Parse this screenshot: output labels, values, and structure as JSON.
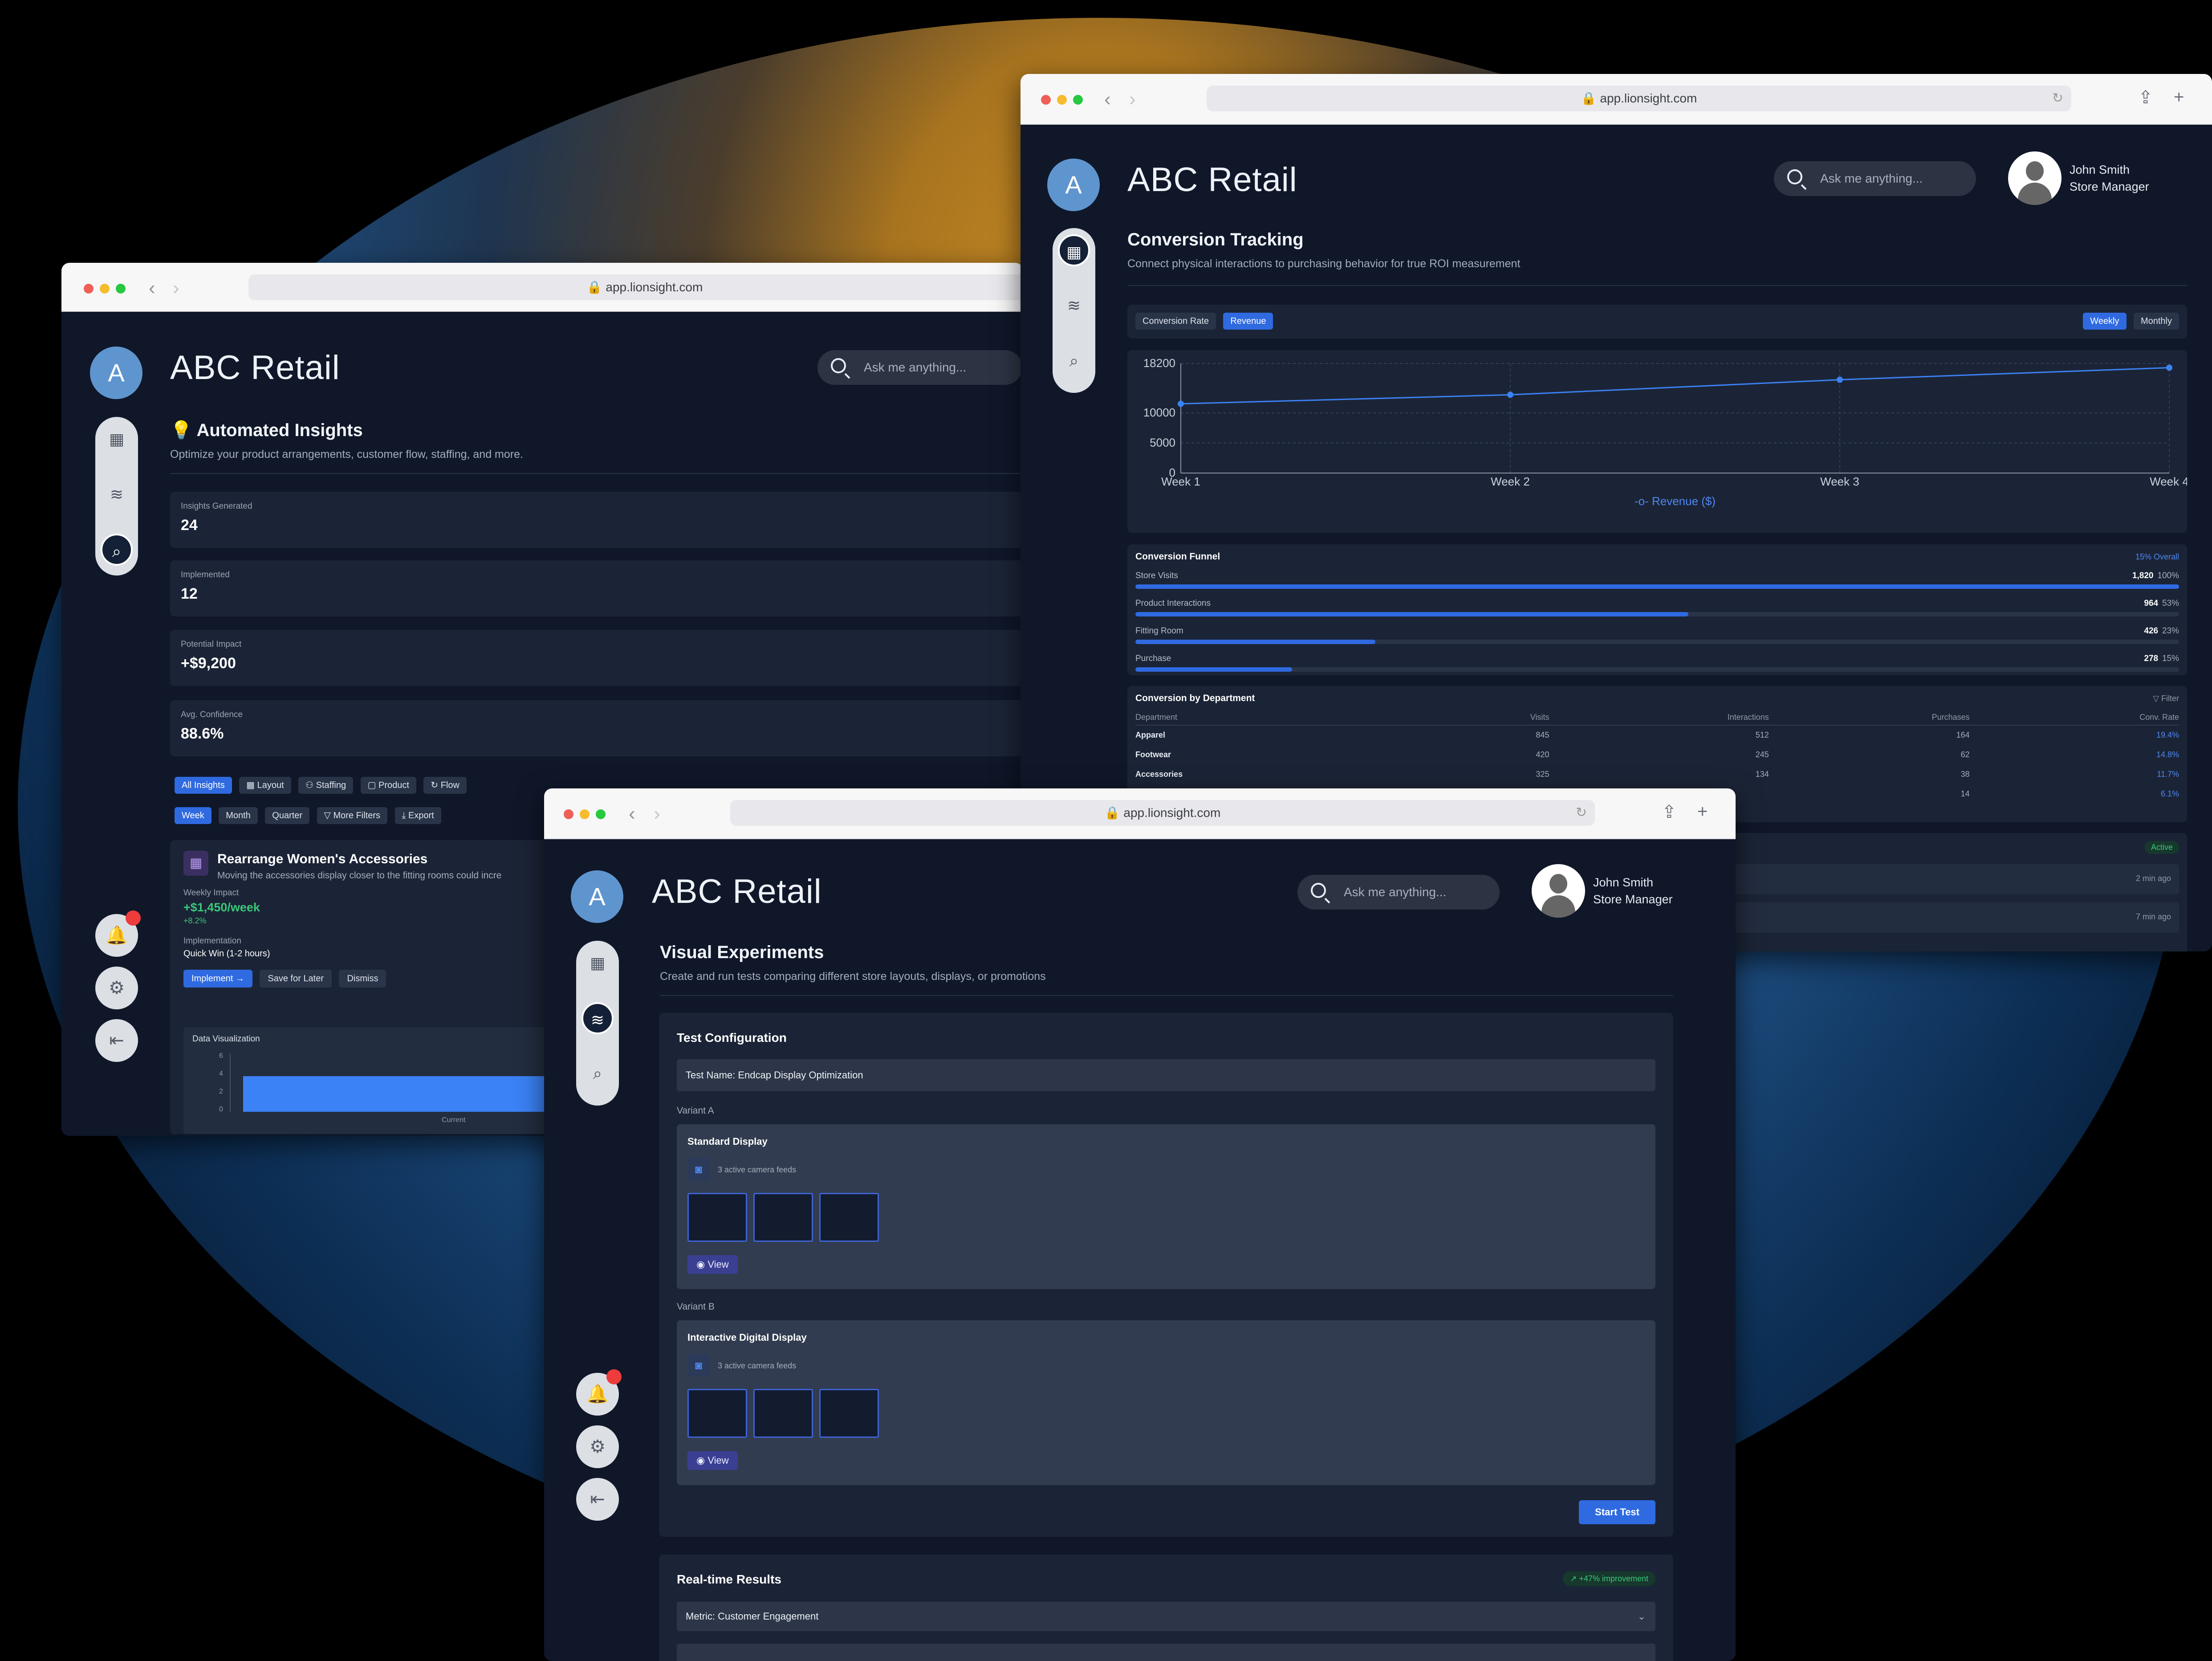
{
  "colors": {
    "accent": "#2f6ae0",
    "success": "#39c87a",
    "danger": "#ee3b3b",
    "panel": "#1b2436",
    "bg": "#0f1729"
  },
  "common": {
    "url": "app.lionsight.com",
    "brand": "ABC Retail",
    "avatar_letter": "A",
    "search_placeholder": "Ask me anything...",
    "user_name": "John Smith",
    "user_role": "Store Manager"
  },
  "insights": {
    "title": "Automated Insights",
    "subtitle": "Optimize your product arrangements, customer flow, staffing, and more.",
    "stats": [
      {
        "label": "Insights Generated",
        "value": "24"
      },
      {
        "label": "Implemented",
        "value": "12"
      },
      {
        "label": "Potential Impact",
        "value": "+$9,200"
      },
      {
        "label": "Avg. Confidence",
        "value": "88.6%"
      }
    ],
    "filters": [
      "All Insights",
      "Layout",
      "Staffing",
      "Product",
      "Flow"
    ],
    "periods": [
      "Week",
      "Month",
      "Quarter",
      "More Filters",
      "Export"
    ],
    "card": {
      "title": "Rearrange Women's Accessories",
      "desc": "Moving the accessories display closer to the fitting rooms could incre",
      "impact_label": "Weekly Impact",
      "impact_value": "+$1,450/week",
      "impact_change": "+8.2%",
      "impl_label": "Implementation",
      "impl_value": "Quick Win (1-2 hours)",
      "buttons": [
        "Implement →",
        "Save for Later",
        "Dismiss"
      ],
      "viz_title": "Data Visualization",
      "viz_ticks": [
        "6",
        "4",
        "2",
        "0"
      ],
      "viz_category": "Current"
    }
  },
  "conversion": {
    "title": "Conversion Tracking",
    "subtitle": "Connect physical interactions to purchasing behavior for true ROI measurement",
    "metric_tabs": [
      "Conversion Rate",
      "Revenue"
    ],
    "period_tabs": [
      "Weekly",
      "Monthly"
    ],
    "funnel": {
      "title": "Conversion Funnel",
      "overall": "15% Overall",
      "rows": [
        {
          "label": "Store Visits",
          "count": "1,820",
          "pct": "100%",
          "fill": 100
        },
        {
          "label": "Product Interactions",
          "count": "964",
          "pct": "53%",
          "fill": 53
        },
        {
          "label": "Fitting Room",
          "count": "426",
          "pct": "23%",
          "fill": 23
        },
        {
          "label": "Purchase",
          "count": "278",
          "pct": "15%",
          "fill": 15
        }
      ]
    },
    "dept": {
      "title": "Conversion by Department",
      "filter": "▽ Filter",
      "headers": [
        "Department",
        "Visits",
        "Interactions",
        "Purchases",
        "Conv. Rate"
      ],
      "rows": [
        [
          "Apparel",
          "845",
          "512",
          "164",
          "19.4%"
        ],
        [
          "Footwear",
          "420",
          "245",
          "62",
          "14.8%"
        ],
        [
          "Accessories",
          "325",
          "134",
          "38",
          "11.7%"
        ],
        [
          "",
          "",
          "",
          "14",
          "6.1%"
        ]
      ]
    },
    "activity": {
      "status": "Active",
      "times": [
        "2 min ago",
        "7 min ago"
      ]
    }
  },
  "chart_data": {
    "type": "line",
    "categories": [
      "Week 1",
      "Week 2",
      "Week 3",
      "Week 4"
    ],
    "series": [
      {
        "name": "Revenue ($)",
        "values": [
          11500,
          13000,
          15500,
          17500
        ]
      }
    ],
    "yticks": [
      0,
      5000,
      10000,
      18200
    ],
    "ylim": [
      0,
      18200
    ],
    "grid": true,
    "legend": "bottom-center"
  },
  "experiments": {
    "title": "Visual Experiments",
    "subtitle": "Create and run tests comparing different store layouts, displays, or promotions",
    "config_title": "Test Configuration",
    "test_name": "Test Name: Endcap Display Optimization",
    "variants": [
      {
        "label": "Variant A",
        "name": "Standard Display",
        "feeds": "3 active camera feeds",
        "view": "View"
      },
      {
        "label": "Variant B",
        "name": "Interactive Digital Display",
        "feeds": "3 active camera feeds",
        "view": "View"
      }
    ],
    "start_button": "Start Test",
    "results_title": "Real-time Results",
    "improvement": "↗ +47% improvement",
    "metric_select": "Metric: Customer Engagement"
  }
}
